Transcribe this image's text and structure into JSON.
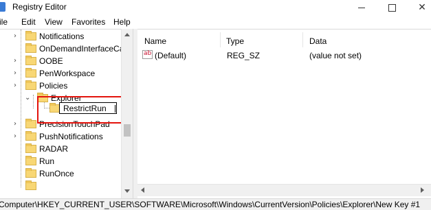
{
  "window": {
    "title": "Registry Editor",
    "controls": {
      "minimize_icon": "minimize-icon",
      "maximize_icon": "maximize-icon",
      "close_icon": "close-icon",
      "close_glyph": "✕"
    }
  },
  "menu": {
    "file": "ile",
    "edit": "Edit",
    "view": "View",
    "favorites": "Favorites",
    "help": "Help"
  },
  "tree": {
    "items": [
      {
        "label": "Notifications",
        "expanded": false
      },
      {
        "label": "OnDemandInterfaceCa",
        "expanded": false
      },
      {
        "label": "OOBE",
        "expanded": false
      },
      {
        "label": "PenWorkspace",
        "expanded": false
      },
      {
        "label": "Policies",
        "expanded": true
      },
      {
        "label": "Explorer",
        "expanded": true
      },
      {
        "label": "PrecisionTouchPad",
        "expanded": false
      },
      {
        "label": "PushNotifications",
        "expanded": false
      },
      {
        "label": "RADAR",
        "expanded": false
      },
      {
        "label": "Run",
        "expanded": false
      },
      {
        "label": "RunOnce",
        "expanded": false
      }
    ],
    "editing_key": {
      "value": "RestrictRun"
    },
    "chevron_collapsed": "›",
    "chevron_expanded": "⌄"
  },
  "list": {
    "columns": {
      "name": "Name",
      "type": "Type",
      "data": "Data"
    },
    "rows": [
      {
        "name": "(Default)",
        "type": "REG_SZ",
        "data": "(value not set)",
        "icon": "string-value-icon",
        "icon_glyph": "ab"
      }
    ]
  },
  "status": {
    "path": "Computer\\HKEY_CURRENT_USER\\SOFTWARE\\Microsoft\\Windows\\CurrentVersion\\Policies\\Explorer\\New Key #1"
  },
  "colors": {
    "highlight": "#e3120b",
    "folder": "#f8d775"
  }
}
